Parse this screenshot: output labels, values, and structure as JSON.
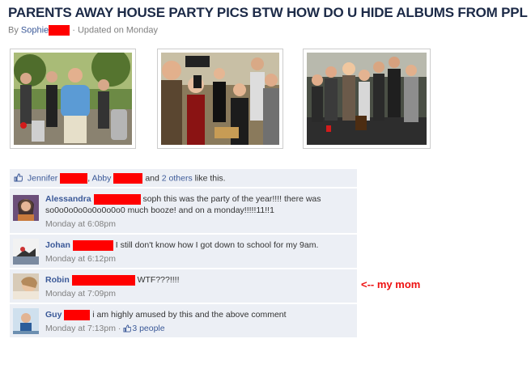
{
  "album": {
    "title": "PARENTS AWAY HOUSE PARTY PICS BTW HOW DO U HIDE ALBUMS FROM PPL",
    "by_label": "By",
    "author": "Sophie",
    "updated": "· Updated on Monday"
  },
  "photos": [
    {
      "alt": "party-photo-1"
    },
    {
      "alt": "party-photo-2"
    },
    {
      "alt": "party-photo-3"
    }
  ],
  "likes": {
    "name1": "Jennifer",
    "sep1": ",",
    "name2": "Abby",
    "and_text": "and",
    "others": "2 others",
    "suffix": "like this."
  },
  "comments": [
    {
      "author": "Alessandra",
      "text": "soph this was the party of the year!!!! there was so0o0o0o0o0o0o0o0 much booze! and on a monday!!!!!11!!1",
      "time": "Monday at 6:08pm"
    },
    {
      "author": "Johan",
      "text": "I still don't know how I got down to school for my 9am.",
      "time": "Monday at 6:12pm"
    },
    {
      "author": "Robin",
      "text": "WTF???!!!!",
      "time": "Monday at 7:09pm"
    },
    {
      "author": "Guy",
      "text": "i am highly amused by this and the above comment",
      "time": "Monday at 7:13pm",
      "dot": "·",
      "likes": "3 people"
    }
  ],
  "annotation": "<-- my mom",
  "colors": {
    "link": "#3b5998",
    "title": "#1c2a47",
    "comment_bg": "#eceff5",
    "redaction": "#ff0000",
    "annotation": "#ee1111"
  }
}
